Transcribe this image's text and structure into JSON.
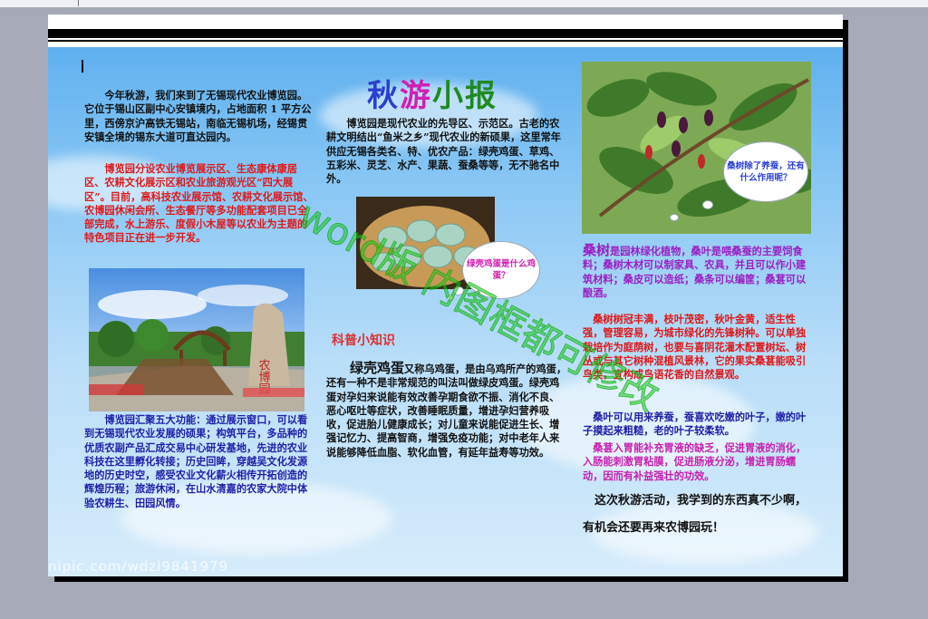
{
  "newspaper_title": [
    "秋",
    "游",
    "小",
    "报"
  ],
  "title_colors": [
    "#2a3fd1",
    "#d11fb3",
    "#1f8a22",
    "#1f8a22"
  ],
  "watermark": "word版 内图框都可修改",
  "site_watermark": "nipic.com/wdzl9841979",
  "col1": {
    "intro": "今年秋游，我们来到了无锡现代农业博览园。它位于锡山区副中心安镇境内，占地面积 1 平方公里，西傍京沪高铁无锡站，南临无锡机场，经锡贯安镇全境的锡东大道可直达园内。",
    "zones": "博览园分设农业博览展示区、生态康体康居区、农耕文化展示区和农业旅游观光区“四大展区”。目前，高科技农业展示馆、农耕文化展示馆、农博园休闲会所、生态餐厅等多功能配套项目已全部完成，水上游乐、度假小木屋等以农业为主题的特色项目正在进一步开发。",
    "functions": "博览园汇聚五大功能：通过展示窗口，可以看到无锡现代农业发展的硕果；构筑平台，多品种的优质农副产品汇成交易中心研发基地，先进的农业科技在这里孵化转接；历史回眸，穿越吴文化发源地的历史时空，感受农业文化薪火相传开拓创造的辉煌历程；旅游休闲，在山水清嘉的农家大院中体验农耕生、田园风情。",
    "gate_text": "农博园"
  },
  "col2": {
    "intro": "博览园是现代农业的先导区、示范区。古老的农耕文明结出“鱼米之乡”现代农业的新硕果，这里常年供应无锡各类名、特、优农产品：绿壳鸡蛋、草鸡、五彩米、灵芝、水产、果蔬、蚕桑等等，无不驰名中外。",
    "egg_bubble": "绿壳鸡蛋是什么鸡蛋？",
    "science_heading": "科普小知识",
    "egg_title": "绿壳鸡蛋",
    "egg_body": "又称乌鸡蛋，是由乌鸡所产的鸡蛋，还有一种不是非常规范的叫法叫做绿皮鸡蛋。绿壳鸡蛋对孕妇来说能有效改善孕期食欲不振、消化不良、恶心呕吐等症状，改善睡眠质量，增进孕妇营养吸收，促进胎儿健康成长；对儿童来说能促进生长、增强记忆力、提高智商，增强免疫功能；对中老年人来说能够降低血脂、软化血管，有延年益寿等功效。"
  },
  "col3": {
    "mulberry_bubble": "桑树除了养蚕，还有什么作用呢？",
    "mulberry_title": "桑树",
    "mulberry_intro": "是园林绿化植物，桑叶是喂桑蚕的主要饲食料；桑树木材可以制家具、农具，并且可以作小建筑材料；桑皮可以造纸；桑条可以编筐；桑葚可以酿酒。",
    "mulberry_red": "桑树树冠丰满，枝叶茂密，秋叶金黄，适生性强，管理容易，为城市绿化的先锋树种。可以单独栽培作为庭荫树，也要与喜阴花灌木配置树坛、树丛或与其它树种混植风景林，它的果实桑葚能吸引鸟类，宜构成鸟语花香的自然景观。",
    "mulberry_blue": "桑叶可以用来养蚕，蚕喜欢吃嫩的叶子，嫩的叶子摸起来粗糙，老的叶子较柔软。",
    "mulberry_purple": "桑葚入胃能补充胃液的缺乏，促进胃液的消化，入肠能刺激胃粘膜，促进肠液分泌，增进胃肠蠕动，因而有补益强壮的功效。",
    "closing": "这次秋游活动，我学到的东西真不少啊，有机会还要再来农博园玩！"
  },
  "colors": {
    "body_black": "#111111",
    "accent_red": "#e01818",
    "deep_blue": "#1f1fa8",
    "purple": "#9a1fc4",
    "magenta": "#c81fb0",
    "sky": "#7cc0f2"
  }
}
